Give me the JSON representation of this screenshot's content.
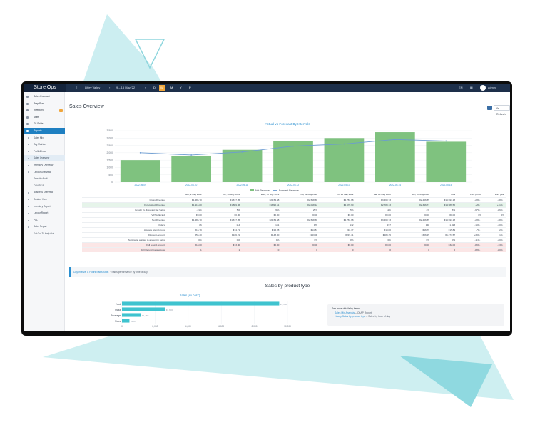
{
  "app": {
    "brand": "Store Ops",
    "store": "Liffey Valley",
    "date_range": "9 – 15 May '22",
    "periods": [
      "D",
      "W",
      "M",
      "Y",
      "P"
    ],
    "active_period": "W",
    "user_label": "admin",
    "right_label": "EN"
  },
  "sidebar": {
    "items": [
      {
        "label": "Sales Forecast",
        "type": "top"
      },
      {
        "label": "Prep Plan",
        "type": "top"
      },
      {
        "label": "Inventory",
        "type": "top",
        "badge": true
      },
      {
        "label": "Staff",
        "type": "top"
      },
      {
        "label": "Till Shifts",
        "type": "top"
      },
      {
        "label": "Reports",
        "type": "active"
      },
      {
        "label": "Sales Mix",
        "type": "sub"
      },
      {
        "label": "Org Metrics",
        "type": "sub"
      },
      {
        "label": "Profit & Loss",
        "type": "sub"
      },
      {
        "label": "Sales Overview",
        "type": "sub-hl"
      },
      {
        "label": "Inventory Overview",
        "type": "sub"
      },
      {
        "label": "Labour Overview",
        "type": "sub"
      },
      {
        "label": "Security Audit",
        "type": "sub"
      },
      {
        "label": "COVID-19",
        "type": "sub"
      },
      {
        "label": "Business Overview",
        "type": "sub"
      },
      {
        "label": "Custom View",
        "type": "sub"
      },
      {
        "label": "Inventory Report",
        "type": "sub"
      },
      {
        "label": "Labour Report",
        "type": "sub"
      },
      {
        "label": "P&L",
        "type": "sub"
      },
      {
        "label": "Sales Report",
        "type": "sub"
      },
      {
        "label": "Eat Out To Help Out",
        "type": "sub"
      }
    ]
  },
  "main": {
    "title": "Sales Overview",
    "refresh_label": "Refresh"
  },
  "chart_data": [
    {
      "type": "bar",
      "title": "Actual vs Forecast By Intervals",
      "categories": [
        "2022-05-09",
        "2022-05-10",
        "2022-05-11",
        "2022-05-12",
        "2022-05-13",
        "2022-05-14",
        "2022-05-15"
      ],
      "series": [
        {
          "name": "Net Revenue",
          "kind": "bar",
          "color": "#7fc27f",
          "values": [
            1500,
            1800,
            2200,
            2800,
            3000,
            3400,
            2750
          ]
        },
        {
          "name": "Forecast Revenue",
          "kind": "line",
          "color": "#6b9bd1",
          "values": [
            2000,
            1850,
            2050,
            2450,
            2600,
            2900,
            2800
          ]
        }
      ],
      "y_ticks": [
        "0",
        "500",
        "1,000",
        "1,500",
        "2,000",
        "2,500",
        "3,000",
        "3,500"
      ],
      "ylim": [
        0,
        3500
      ],
      "legend": "bottom"
    },
    {
      "type": "bar",
      "orientation": "horizontal",
      "title": "Sales (ex. VAT)",
      "categories": [
        "Food",
        "Pizza",
        "Beverage",
        "Sides"
      ],
      "values": [
        9500,
        2600,
        1150,
        450
      ],
      "value_labels": [
        "€9,500",
        "€2,600",
        "€1,150",
        "€450"
      ],
      "x_ticks": [
        "0",
        "2,000",
        "4,000",
        "6,000",
        "8,000",
        "10,000"
      ],
      "xlim": [
        0,
        10000
      ],
      "color": "#3fc3cf"
    }
  ],
  "table": {
    "headers": [
      "",
      "Mon, 9 May 2022",
      "Tue, 10 May 2022",
      "Wed, 11 May 2022",
      "Thu, 12 May 2022",
      "Fri, 13 May 2022",
      "Sat, 14 May 2022",
      "Sun, 15 May 2022",
      "Total",
      "Prev period",
      "Prev year"
    ],
    "rows": [
      {
        "style": "",
        "cells": [
          "Gross Revenue",
          "€1,486.70",
          "€1,677.05",
          "€2,154.48",
          "€2,518.69",
          "€2,781.98",
          "€3,460.73",
          "€2,466.85",
          "€16,591.18",
          "-23% ↓",
          "-48% ↓"
        ]
      },
      {
        "style": "green",
        "cells": [
          "Forecasted Revenue",
          "€1,916.80",
          "€1,869.96",
          "€1,890.61",
          "€2,018.12",
          "€2,570.90",
          "€2,780.13",
          "€2,396.77",
          "€14,986.50",
          "+8% ↑",
          "+11% ↑"
        ]
      },
      {
        "style": "",
        "cells": [
          "Growth vs. Forecast Net Sales",
          "-21%",
          "5%",
          "20%",
          "25%",
          "5%",
          "11%",
          "4%",
          "5%",
          "-67% ↓",
          "-86% ↓"
        ]
      },
      {
        "style": "",
        "cells": [
          "VAT collected",
          "€0.00",
          "€0.00",
          "€0.00",
          "€0.00",
          "€0.00",
          "€0.00",
          "€0.00",
          "€0.00",
          "0%",
          "0%"
        ]
      },
      {
        "style": "",
        "cells": [
          "Net Revenue",
          "€1,486.70",
          "€1,677.05",
          "€2,154.48",
          "€2,518.69",
          "€2,781.98",
          "€3,460.73",
          "€2,466.85",
          "€16,591.18",
          "-23% ↓",
          "-48% ↓"
        ]
      },
      {
        "style": "",
        "cells": [
          "Orders",
          "86",
          "114",
          "141",
          "170",
          "172",
          "197",
          "148",
          "1,023",
          "-15% ↓",
          "-40% ↓"
        ]
      },
      {
        "style": "",
        "cells": [
          "Average spend gross",
          "€16.79",
          "€14.71",
          "€15.28",
          "€14.81",
          "€16.17",
          "€18.00",
          "€16.79",
          "€15.89",
          "-7% ↓",
          "-2% ↓"
        ]
      },
      {
        "style": "",
        "cells": [
          "Discount Amount",
          "€55.40",
          "€106.21",
          "€148.00",
          "€143.08",
          "€215.41",
          "€289.15",
          "€306.25",
          "€1,271.57",
          "+35% ↑",
          "-1% ↓"
        ]
      },
      {
        "style": "",
        "cells": [
          "Surcharge applied to amount in sales",
          "0%",
          "0%",
          "0%",
          "0%",
          "0%",
          "0%",
          "0%",
          "0%",
          "-11% ↓",
          "-20% ↓"
        ]
      },
      {
        "style": "red",
        "cells": [
          "Full refund amount",
          "€18.00",
          "€13.80",
          "€0.00",
          "€0.00",
          "€0.00",
          "€0.00",
          "€0.00",
          "€32.00",
          "-86% ↓",
          "-13% ↓"
        ]
      },
      {
        "style": "red",
        "cells": [
          "Full Refund transactions",
          "1",
          "1",
          "0",
          "0",
          "0",
          "0",
          "0",
          "2",
          "-80% ↓",
          "-80% ↓"
        ]
      }
    ]
  },
  "panel": {
    "link": "Day Interval & Hours Sales Stats",
    "desc": "Sales performance by time of day"
  },
  "product": {
    "section_title": "Sales by product type",
    "info_title": "See more details by items",
    "info_links": [
      {
        "link": "Sales Mix Analysis",
        "desc": "OLAP Report"
      },
      {
        "link": "Hourly Sales by product type",
        "desc": "Sales by hour of day"
      }
    ]
  }
}
